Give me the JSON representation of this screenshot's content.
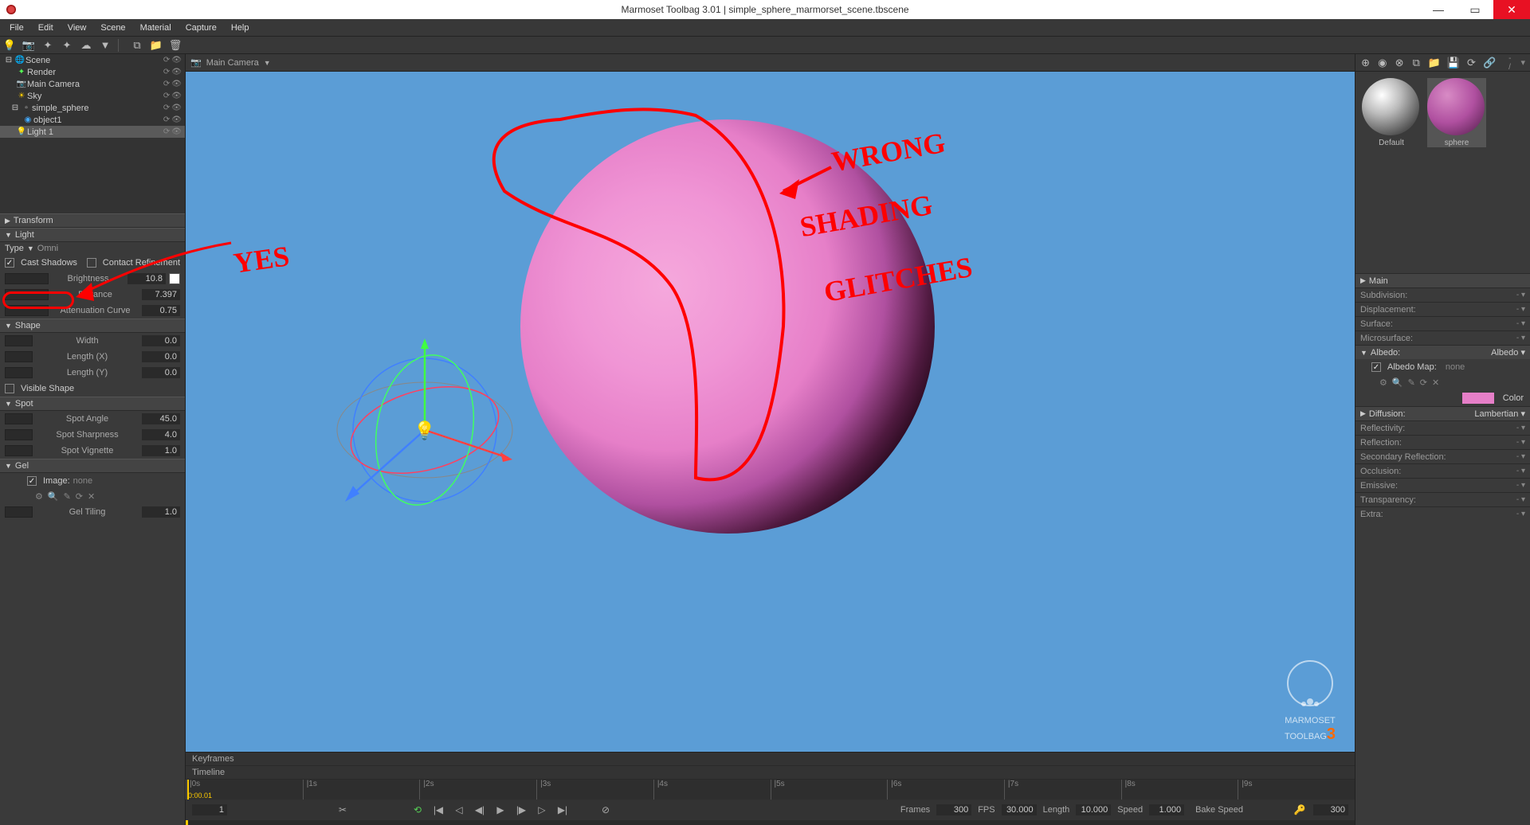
{
  "app": {
    "title": "Marmoset Toolbag 3.01  |  simple_sphere_marmorset_scene.tbscene"
  },
  "menu": [
    "File",
    "Edit",
    "View",
    "Scene",
    "Material",
    "Capture",
    "Help"
  ],
  "viewport_header": {
    "camera": "Main Camera"
  },
  "scene_tree": {
    "root": "Scene",
    "items": [
      {
        "label": "Render",
        "indent": 1
      },
      {
        "label": "Main Camera",
        "indent": 1
      },
      {
        "label": "Sky",
        "indent": 1
      },
      {
        "label": "simple_sphere",
        "indent": 1
      },
      {
        "label": "object1",
        "indent": 2
      },
      {
        "label": "Light 1",
        "indent": 1,
        "selected": true
      }
    ]
  },
  "inspector": {
    "transform_header": "Transform",
    "light_header": "Light",
    "type_label": "Type",
    "type_value": "Omni",
    "cast_shadows": "Cast Shadows",
    "contact_refinement": "Contact Refinement",
    "brightness_label": "Brightness",
    "brightness_value": "10.8",
    "distance_label": "Distance",
    "distance_value": "7.397",
    "attenuation_label": "Attenuation Curve",
    "attenuation_value": "0.75",
    "shape_header": "Shape",
    "width_label": "Width",
    "width_value": "0.0",
    "lengthx_label": "Length (X)",
    "lengthx_value": "0.0",
    "lengthy_label": "Length (Y)",
    "lengthy_value": "0.0",
    "visible_shape": "Visible Shape",
    "spot_header": "Spot",
    "spot_angle_label": "Spot Angle",
    "spot_angle_value": "45.0",
    "spot_sharpness_label": "Spot Sharpness",
    "spot_sharpness_value": "4.0",
    "spot_vignette_label": "Spot Vignette",
    "spot_vignette_value": "1.0",
    "gel_header": "Gel",
    "gel_image_label": "Image:",
    "gel_image_value": "none",
    "gel_tiling_label": "Gel Tiling",
    "gel_tiling_value": "1.0"
  },
  "annotations": {
    "yes": "YES",
    "wrong": "WRONG",
    "shading": "SHADING",
    "glitches": "GLITCHES"
  },
  "timeline": {
    "keyframes": "Keyframes",
    "timeline": "Timeline",
    "ticks": [
      "|0s",
      "|1s",
      "|2s",
      "|3s",
      "|4s",
      "|5s",
      "|6s",
      "|7s",
      "|8s",
      "|9s"
    ],
    "cur_time": "0:00.01",
    "cur_frame": "1",
    "frames_label": "Frames",
    "frames_value": "300",
    "fps_label": "FPS",
    "fps_value": "30.000",
    "length_label": "Length",
    "length_value": "10.000",
    "speed_label": "Speed",
    "speed_value": "1.000",
    "bake_speed": "Bake Speed",
    "end_frame": "300"
  },
  "materials": {
    "default": "Default",
    "sphere": "sphere",
    "main": "Main",
    "subdivision": "Subdivision:",
    "displacement": "Displacement:",
    "surface": "Surface:",
    "microsurface": "Microsurface:",
    "albedo_header": "Albedo:",
    "albedo_mode": "Albedo",
    "albedo_map_label": "Albedo Map:",
    "albedo_map_value": "none",
    "color_label": "Color",
    "diffusion_header": "Diffusion:",
    "diffusion_mode": "Lambertian",
    "reflectivity": "Reflectivity:",
    "reflection": "Reflection:",
    "secondary_reflection": "Secondary Reflection:",
    "occlusion": "Occlusion:",
    "emissive": "Emissive:",
    "transparency": "Transparency:",
    "extra": "Extra:"
  },
  "watermark": {
    "line1": "MARMOSET",
    "line2": "TOOLBAG"
  }
}
